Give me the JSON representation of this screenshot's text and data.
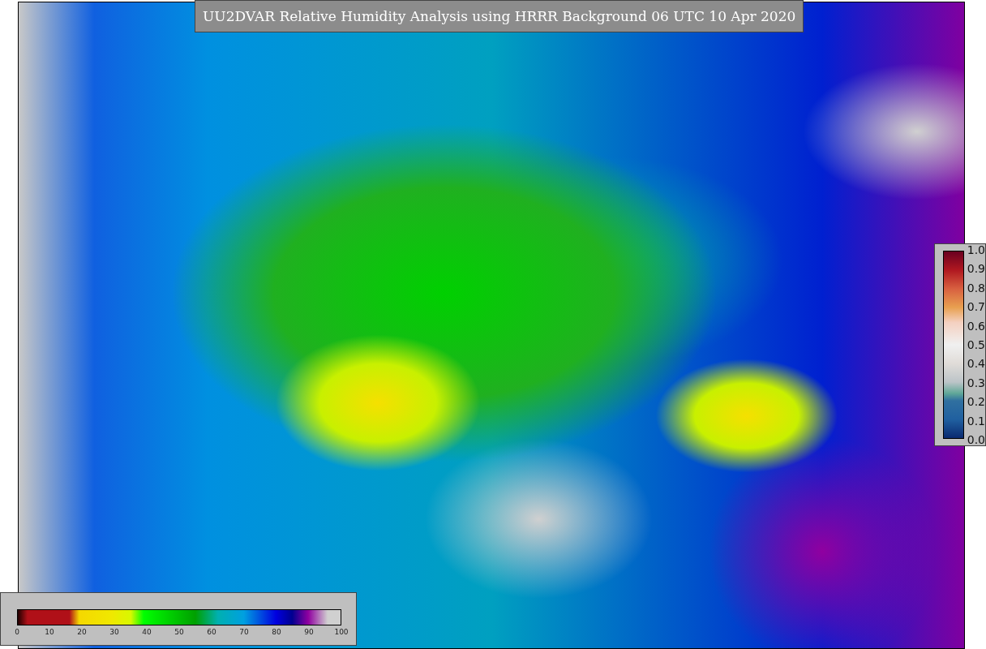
{
  "title": "UU2DVAR Relative Humidity Analysis using HRRR Background 06 UTC 10 Apr 2020",
  "colorbars": [
    {
      "kind": "vertical",
      "ticks": [
        "1.0",
        "0.9",
        "0.8",
        "0.7",
        "0.6",
        "0.5",
        "0.4",
        "0.3",
        "0.2",
        "0.1",
        "0.0"
      ]
    },
    {
      "kind": "horizontal",
      "ticks": [
        "0",
        "10",
        "20",
        "30",
        "40",
        "50",
        "60",
        "70",
        "80",
        "90",
        "100"
      ]
    }
  ]
}
